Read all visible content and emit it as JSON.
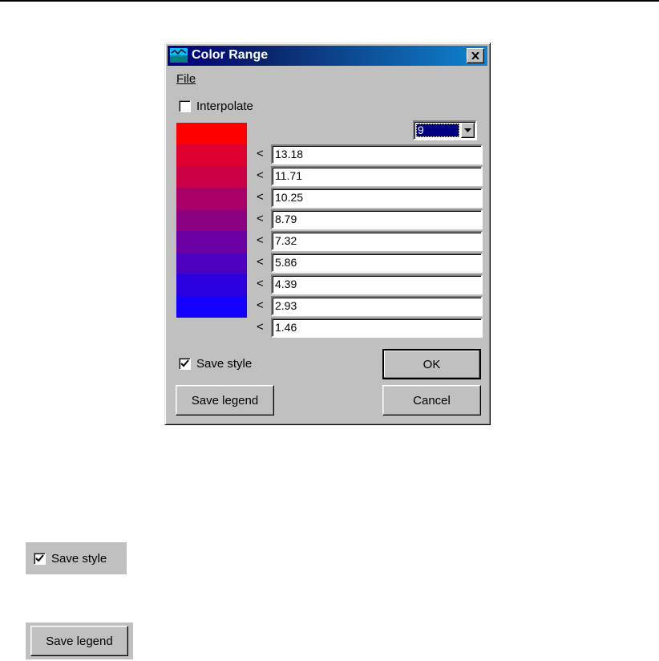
{
  "window": {
    "title": "Color Range",
    "close_glyph": "✕"
  },
  "menu": {
    "file_label": "File"
  },
  "interpolate": {
    "label": "Interpolate",
    "checked": false
  },
  "class_count": {
    "value": "9"
  },
  "swatches": [
    "#ff0000",
    "#e00030",
    "#cc0044",
    "#a80066",
    "#8c0082",
    "#6a00a4",
    "#4c00c0",
    "#2a00e0",
    "#1400ff"
  ],
  "range_prefix": "<",
  "ranges": [
    "13.18",
    "11.71",
    "10.25",
    "8.79",
    "7.32",
    "5.86",
    "4.39",
    "2.93",
    "1.46"
  ],
  "save_style": {
    "label": "Save style",
    "checked": true
  },
  "buttons": {
    "ok": "OK",
    "cancel": "Cancel",
    "save_legend": "Save legend"
  },
  "samples": {
    "save_style_label": "Save style",
    "save_legend_label": "Save legend"
  }
}
